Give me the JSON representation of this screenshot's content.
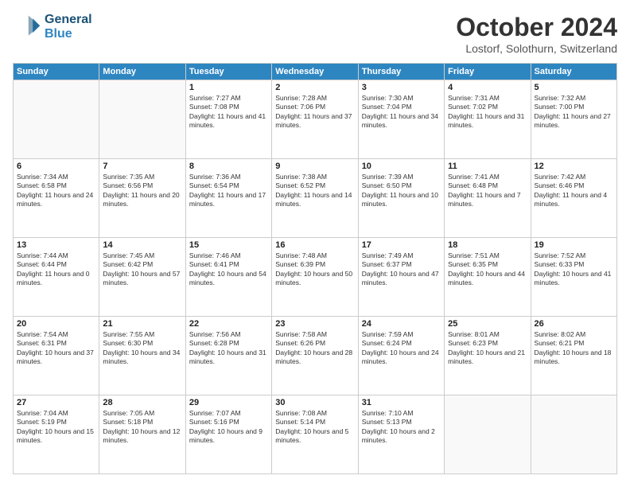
{
  "header": {
    "logo_line1": "General",
    "logo_line2": "Blue",
    "title": "October 2024",
    "location": "Lostorf, Solothurn, Switzerland"
  },
  "weekdays": [
    "Sunday",
    "Monday",
    "Tuesday",
    "Wednesday",
    "Thursday",
    "Friday",
    "Saturday"
  ],
  "weeks": [
    [
      {
        "day": "",
        "detail": ""
      },
      {
        "day": "",
        "detail": ""
      },
      {
        "day": "1",
        "detail": "Sunrise: 7:27 AM\nSunset: 7:08 PM\nDaylight: 11 hours and 41 minutes."
      },
      {
        "day": "2",
        "detail": "Sunrise: 7:28 AM\nSunset: 7:06 PM\nDaylight: 11 hours and 37 minutes."
      },
      {
        "day": "3",
        "detail": "Sunrise: 7:30 AM\nSunset: 7:04 PM\nDaylight: 11 hours and 34 minutes."
      },
      {
        "day": "4",
        "detail": "Sunrise: 7:31 AM\nSunset: 7:02 PM\nDaylight: 11 hours and 31 minutes."
      },
      {
        "day": "5",
        "detail": "Sunrise: 7:32 AM\nSunset: 7:00 PM\nDaylight: 11 hours and 27 minutes."
      }
    ],
    [
      {
        "day": "6",
        "detail": "Sunrise: 7:34 AM\nSunset: 6:58 PM\nDaylight: 11 hours and 24 minutes."
      },
      {
        "day": "7",
        "detail": "Sunrise: 7:35 AM\nSunset: 6:56 PM\nDaylight: 11 hours and 20 minutes."
      },
      {
        "day": "8",
        "detail": "Sunrise: 7:36 AM\nSunset: 6:54 PM\nDaylight: 11 hours and 17 minutes."
      },
      {
        "day": "9",
        "detail": "Sunrise: 7:38 AM\nSunset: 6:52 PM\nDaylight: 11 hours and 14 minutes."
      },
      {
        "day": "10",
        "detail": "Sunrise: 7:39 AM\nSunset: 6:50 PM\nDaylight: 11 hours and 10 minutes."
      },
      {
        "day": "11",
        "detail": "Sunrise: 7:41 AM\nSunset: 6:48 PM\nDaylight: 11 hours and 7 minutes."
      },
      {
        "day": "12",
        "detail": "Sunrise: 7:42 AM\nSunset: 6:46 PM\nDaylight: 11 hours and 4 minutes."
      }
    ],
    [
      {
        "day": "13",
        "detail": "Sunrise: 7:44 AM\nSunset: 6:44 PM\nDaylight: 11 hours and 0 minutes."
      },
      {
        "day": "14",
        "detail": "Sunrise: 7:45 AM\nSunset: 6:42 PM\nDaylight: 10 hours and 57 minutes."
      },
      {
        "day": "15",
        "detail": "Sunrise: 7:46 AM\nSunset: 6:41 PM\nDaylight: 10 hours and 54 minutes."
      },
      {
        "day": "16",
        "detail": "Sunrise: 7:48 AM\nSunset: 6:39 PM\nDaylight: 10 hours and 50 minutes."
      },
      {
        "day": "17",
        "detail": "Sunrise: 7:49 AM\nSunset: 6:37 PM\nDaylight: 10 hours and 47 minutes."
      },
      {
        "day": "18",
        "detail": "Sunrise: 7:51 AM\nSunset: 6:35 PM\nDaylight: 10 hours and 44 minutes."
      },
      {
        "day": "19",
        "detail": "Sunrise: 7:52 AM\nSunset: 6:33 PM\nDaylight: 10 hours and 41 minutes."
      }
    ],
    [
      {
        "day": "20",
        "detail": "Sunrise: 7:54 AM\nSunset: 6:31 PM\nDaylight: 10 hours and 37 minutes."
      },
      {
        "day": "21",
        "detail": "Sunrise: 7:55 AM\nSunset: 6:30 PM\nDaylight: 10 hours and 34 minutes."
      },
      {
        "day": "22",
        "detail": "Sunrise: 7:56 AM\nSunset: 6:28 PM\nDaylight: 10 hours and 31 minutes."
      },
      {
        "day": "23",
        "detail": "Sunrise: 7:58 AM\nSunset: 6:26 PM\nDaylight: 10 hours and 28 minutes."
      },
      {
        "day": "24",
        "detail": "Sunrise: 7:59 AM\nSunset: 6:24 PM\nDaylight: 10 hours and 24 minutes."
      },
      {
        "day": "25",
        "detail": "Sunrise: 8:01 AM\nSunset: 6:23 PM\nDaylight: 10 hours and 21 minutes."
      },
      {
        "day": "26",
        "detail": "Sunrise: 8:02 AM\nSunset: 6:21 PM\nDaylight: 10 hours and 18 minutes."
      }
    ],
    [
      {
        "day": "27",
        "detail": "Sunrise: 7:04 AM\nSunset: 5:19 PM\nDaylight: 10 hours and 15 minutes."
      },
      {
        "day": "28",
        "detail": "Sunrise: 7:05 AM\nSunset: 5:18 PM\nDaylight: 10 hours and 12 minutes."
      },
      {
        "day": "29",
        "detail": "Sunrise: 7:07 AM\nSunset: 5:16 PM\nDaylight: 10 hours and 9 minutes."
      },
      {
        "day": "30",
        "detail": "Sunrise: 7:08 AM\nSunset: 5:14 PM\nDaylight: 10 hours and 5 minutes."
      },
      {
        "day": "31",
        "detail": "Sunrise: 7:10 AM\nSunset: 5:13 PM\nDaylight: 10 hours and 2 minutes."
      },
      {
        "day": "",
        "detail": ""
      },
      {
        "day": "",
        "detail": ""
      }
    ]
  ]
}
